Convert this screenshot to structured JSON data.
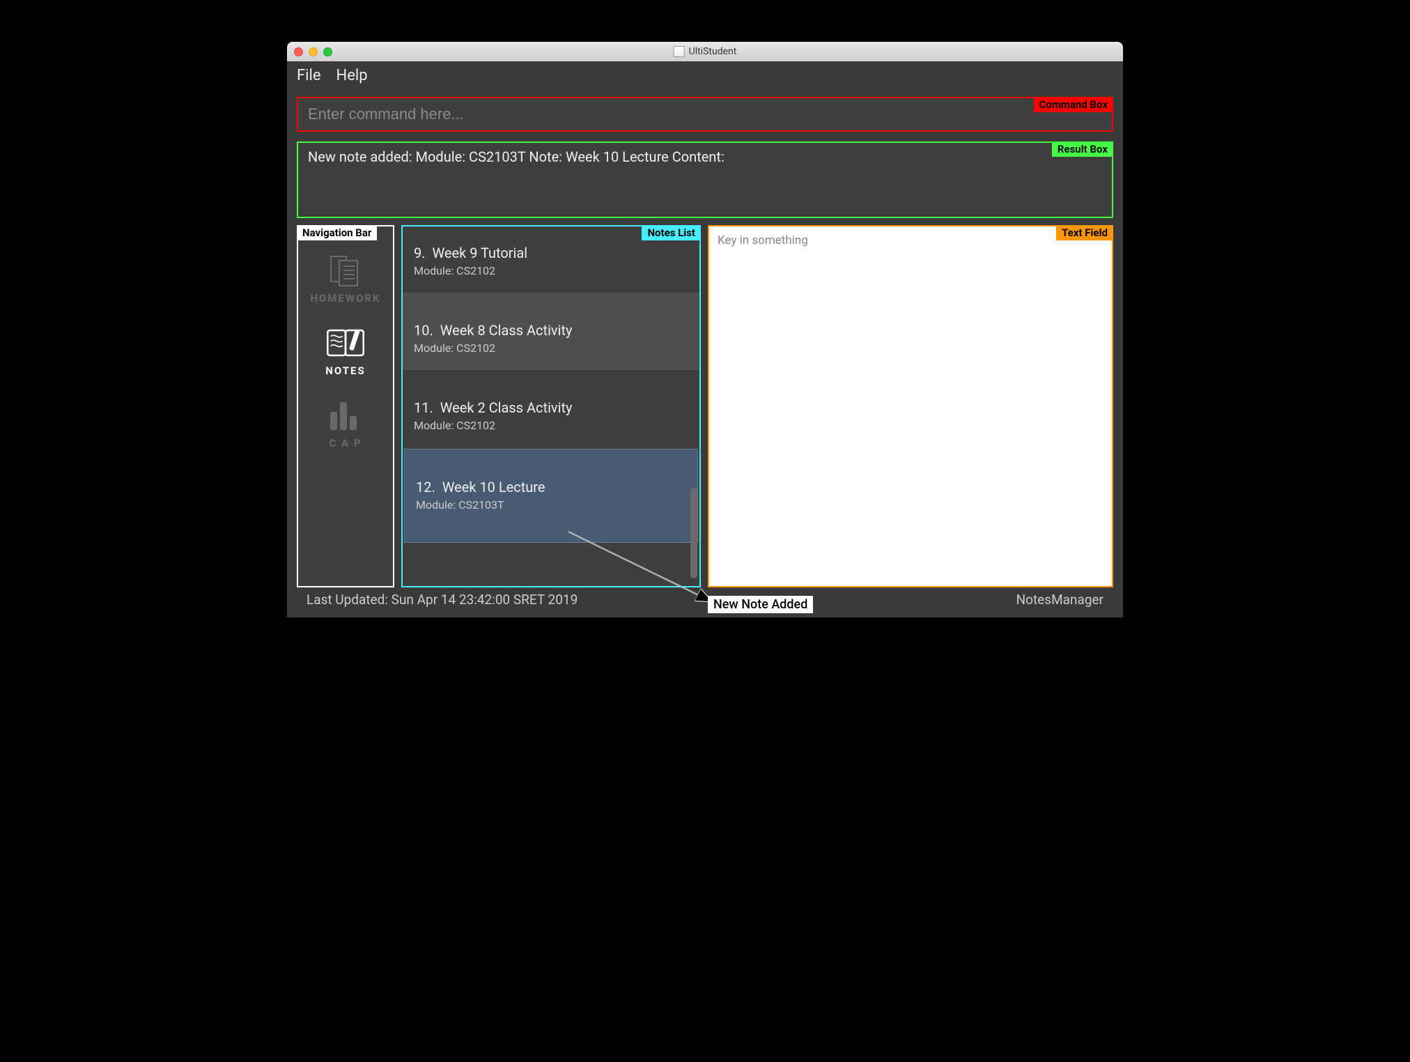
{
  "window": {
    "title": "UltiStudent"
  },
  "menu": {
    "file": "File",
    "help": "Help"
  },
  "labels": {
    "command": "Command Box",
    "result": "Result Box",
    "nav": "Navigation Bar",
    "notes": "Notes List",
    "text": "Text Field",
    "callout": "New Note Added"
  },
  "command": {
    "placeholder": "Enter command here..."
  },
  "result": {
    "text": "New note added:  Module: CS2103T Note: Week 10 Lecture Content:"
  },
  "nav": {
    "homework": "HOMEWORK",
    "notes": "NOTES",
    "cap": "C A P"
  },
  "notes": [
    {
      "index": "9.",
      "title": "Week 9 Tutorial",
      "module": "Module: CS2102"
    },
    {
      "index": "10.",
      "title": "Week 8 Class Activity",
      "module": "Module: CS2102"
    },
    {
      "index": "11.",
      "title": "Week 2 Class Activity",
      "module": "Module: CS2102"
    },
    {
      "index": "12.",
      "title": "Week 10 Lecture",
      "module": "Module: CS2103T"
    }
  ],
  "textfield": {
    "placeholder": "Key in something"
  },
  "status": {
    "left": "Last Updated: Sun Apr 14 23:42:00 SRET 2019",
    "right": "NotesManager"
  }
}
